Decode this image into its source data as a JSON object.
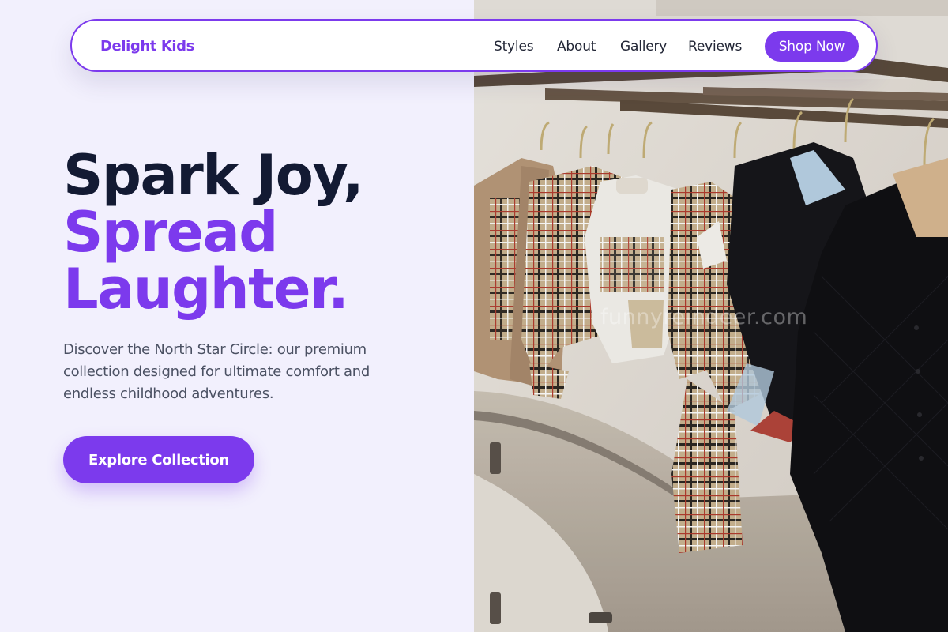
{
  "nav": {
    "brand": "Delight Kids",
    "links": [
      "Styles",
      "About",
      "Gallery",
      "Reviews"
    ],
    "cta": "Shop Now"
  },
  "hero": {
    "headline_line1": "Spark Joy,",
    "headline_line2": "Spread",
    "headline_line3": "Laughter.",
    "subtitle": "Discover the North Star Circle: our premium collection designed for ultimate comfort and endless childhood adventures.",
    "cta": "Explore Collection"
  },
  "image": {
    "watermark": "funnyreindeer.com",
    "description_icon": "clothing-rack-photo"
  },
  "colors": {
    "accent": "#7c3aed",
    "headline_dark": "#131a33",
    "page_bg": "#f2f0fd",
    "body_text": "#4b5163"
  }
}
